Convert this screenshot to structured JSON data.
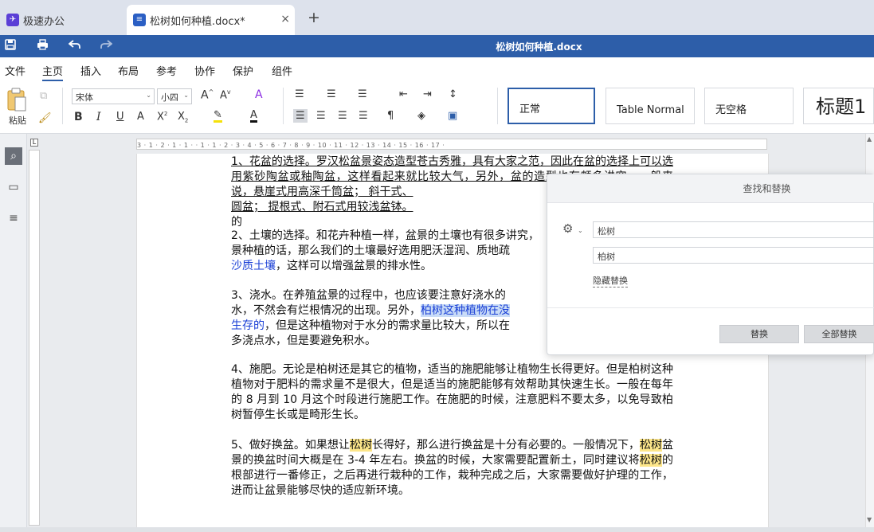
{
  "tabs": [
    {
      "label": "极速办公",
      "icon": "app-logo-icon"
    },
    {
      "label": "松树如何种植.docx*",
      "icon": "document-icon",
      "close": "×"
    }
  ],
  "add_tab": "+",
  "titlebar": {
    "title": "松树如何种植.docx"
  },
  "menu": [
    "文件",
    "主页",
    "插入",
    "布局",
    "参考",
    "协作",
    "保护",
    "组件"
  ],
  "menu_active": "主页",
  "ribbon": {
    "paste_label": "粘贴",
    "font_name": "宋体",
    "font_size": "小四",
    "styles": [
      "正常",
      "Table Normal",
      "无空格",
      "标题1"
    ]
  },
  "ruler": {
    "ticks": "3 · 1 · 2 · 1 · 1 ·  · 1 · 1 · 2 · 3 · 4 · 5 · 6 · 7 · 8 · 9 · 10 · 11 · 12 · 13 · 14 · 15 · 16 · 17 ·"
  },
  "document": {
    "p1": {
      "t1": "1、花盆的选择。罗汉松盆景姿态造型苍古秀雅，具有大家之范，因此在盆的选择上可以选用紫砂陶盆或釉陶盆，这样看起来就比较大气，另外，盆的造型也有颇多讲究，一般来说，悬崖式用高深千筒盆；  斜干式、",
      "t2": "圆盆；  提根式、附石式用较浅盆钵。",
      "t3": "的"
    },
    "p2": {
      "t1": "2、土壤的选择。和花卉种植一样，盆景的土壤也有很多讲究，",
      "t2": "景种植的话，那么我们的土壤最好选用肥沃湿润、质地疏",
      "t3": "沙质土壤",
      "t4": "，这样可以增强盆景的排水性。"
    },
    "p3": {
      "t1": "3、浇水。在养殖盆景的过程中，也应该要注意好浇水的",
      "t2": "水，不然会有烂根情况的出现。另外，",
      "t3": "柏树这种植物在没",
      "t4": "生存的",
      "t5": "，但是这种植物对于水分的需求量比较大，所以在",
      "t6": "多浇点水，但是要避免积水。"
    },
    "p4": "4、施肥。无论是柏树还是其它的植物，适当的施肥能够让植物生长得更好。但是柏树这种植物对于肥料的需求量不是很大，但是适当的施肥能够有效帮助其快速生长。一般在每年的 8 月到 10 月这个时段进行施肥工作。在施肥的时候，注意肥料不要太多，以免导致柏树暂停生长或是畸形生长。",
    "p5": {
      "t1": "5、做好换盆。如果想让",
      "h1": "松树",
      "t2": "长得好，那么进行换盆是十分有必要的。一般情况下，",
      "h2": "松树",
      "t3": "盆景的换盆时间大概是在 3-4 年左右。换盆的时候，大家需要配置新土，同时建议将",
      "h3": "松树",
      "t4": "的根部进行一番修正，之后再进行栽种的工作，栽种完成之后，大家需要做好护理的工作，进而让盆景能够尽快的适应新环境。"
    }
  },
  "find_replace": {
    "title": "查找和替换",
    "find_value": "松树",
    "replace_value": "柏树",
    "hide_replace": "隐藏替换",
    "replace_btn": "替换",
    "replace_all_btn": "全部替换"
  }
}
